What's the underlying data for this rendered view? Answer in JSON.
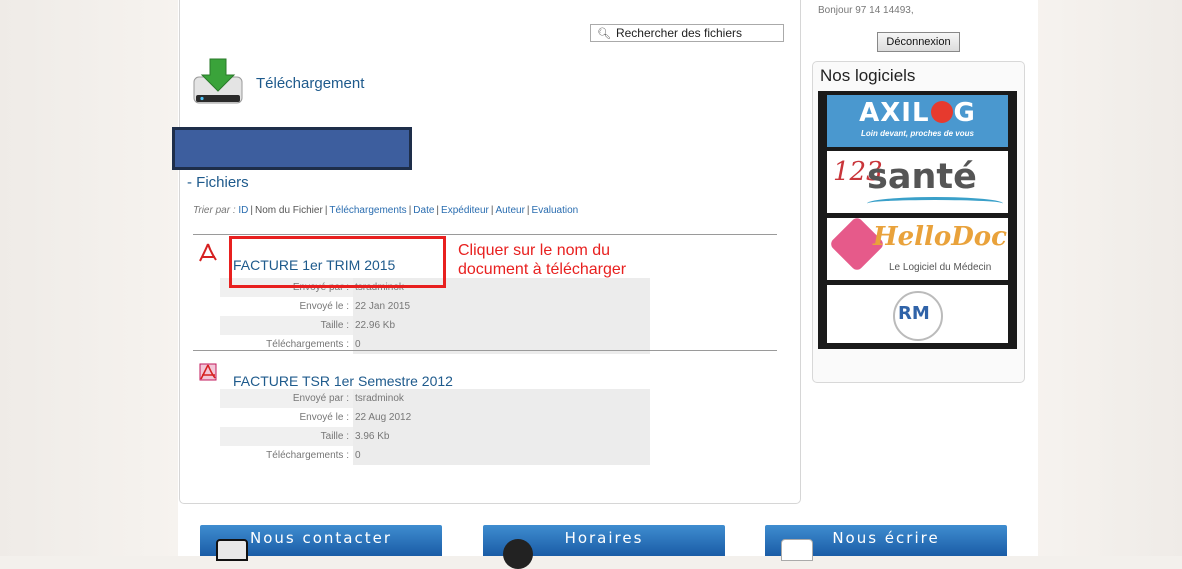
{
  "search": {
    "label": "Rechercher des fichiers"
  },
  "section": {
    "title": "Téléchargement",
    "subtitle": "- Fichiers"
  },
  "sort": {
    "prefix": "Trier par :",
    "options": [
      "ID",
      "Nom du Fichier",
      "Téléchargements",
      "Date",
      "Expéditeur",
      "Auteur",
      "Evaluation"
    ],
    "active": "Nom du Fichier"
  },
  "files": [
    {
      "title": "FACTURE 1er TRIM 2015",
      "fields": [
        {
          "label": "Envoyé par :",
          "value": "tsradminok"
        },
        {
          "label": "Envoyé le :",
          "value": "22 Jan 2015"
        },
        {
          "label": "Taille :",
          "value": "22.96 Kb"
        },
        {
          "label": "Téléchargements :",
          "value": "0"
        }
      ]
    },
    {
      "title": "FACTURE TSR 1er Semestre 2012",
      "fields": [
        {
          "label": "Envoyé par :",
          "value": "tsradminok"
        },
        {
          "label": "Envoyé le :",
          "value": "22 Aug 2012"
        },
        {
          "label": "Taille :",
          "value": "3.96 Kb"
        },
        {
          "label": "Téléchargements :",
          "value": "0"
        }
      ]
    }
  ],
  "annotation": {
    "line1": "Cliquer sur le nom du",
    "line2": "document à télécharger",
    "color": "#e8201f"
  },
  "sidebar": {
    "greeting": "Bonjour 97 14 14493,",
    "logout": "Déconnexion",
    "title": "Nos logiciels",
    "logos": [
      {
        "name": "AXILOG",
        "brand_pre": "AXIL",
        "brand_post": "G",
        "tagline": "Loin devant, proches de vous"
      },
      {
        "name": "123 santé",
        "num": "123",
        "word": "santé"
      },
      {
        "name": "HelloDoc",
        "word": "HelloDoc",
        "tagline": "Le Logiciel du Médecin"
      },
      {
        "name": "RM",
        "word": "RM"
      }
    ]
  },
  "footer": {
    "buttons": [
      "Nous contacter",
      "Horaires",
      "Nous écrire"
    ]
  },
  "colors": {
    "link": "#1e5a8c",
    "accent_blue": "#2a6db0",
    "redaction": "#3d5e9e"
  }
}
